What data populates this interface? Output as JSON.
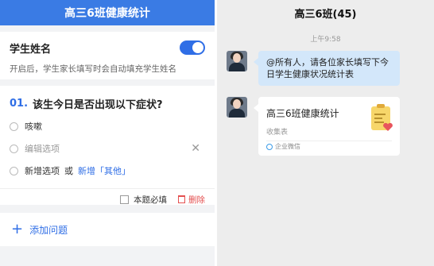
{
  "left": {
    "header_title": "高三6班健康统计",
    "student_name": {
      "title": "学生姓名",
      "description": "开启后，学生家长填写时会自动填充学生姓名",
      "toggle_on": true
    },
    "question": {
      "number": "01.",
      "title": "该生今日是否出现以下症状?",
      "options": [
        "咳嗽",
        "编辑选项"
      ],
      "add_option": "新增选项",
      "or_text": "或",
      "add_other": "新增「其他」",
      "required_label": "本题必填",
      "delete_label": "删除"
    },
    "add_question": "添加问题"
  },
  "right": {
    "header_title": "高三6班(45)",
    "timestamp": "上午9:58",
    "message": "@所有人，请各位家长填写下今日学生健康状况统计表",
    "card": {
      "title": "高三6班健康统计",
      "subtitle": "收集表",
      "footer": "企业微信"
    }
  },
  "colors": {
    "accent": "#2f6ee6",
    "header_blue": "#3a7be4",
    "bubble": "#d3e7fa",
    "delete": "#e45050"
  }
}
